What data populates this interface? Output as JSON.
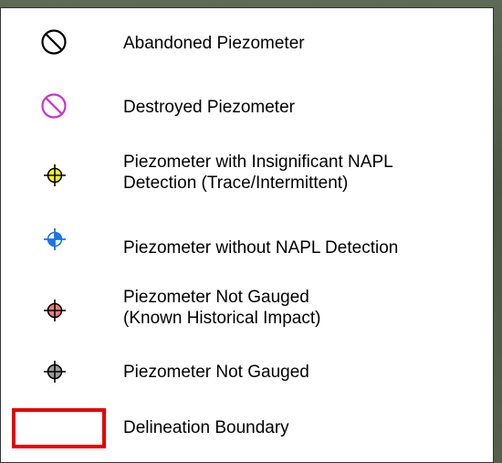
{
  "legend": {
    "items": [
      {
        "label": "Abandoned Piezometer",
        "symbol": "abandoned-piezometer-icon",
        "color": "#000000"
      },
      {
        "label": "Destroyed Piezometer",
        "symbol": "destroyed-piezometer-icon",
        "color": "#cc33cc"
      },
      {
        "label": "Piezometer with Insignificant NAPL\nDetection (Trace/Intermittent)",
        "symbol": "insignificant-napl-piezometer-icon",
        "color": "#ffff00"
      },
      {
        "label": "Piezometer without NAPL Detection",
        "symbol": "no-napl-piezometer-icon",
        "color": "#1a73e8"
      },
      {
        "label": "Piezometer Not Gauged\n(Known Historical Impact)",
        "symbol": "not-gauged-impact-piezometer-icon",
        "color": "#ef7b7b"
      },
      {
        "label": "Piezometer Not Gauged",
        "symbol": "not-gauged-piezometer-icon",
        "color": "#9a9a9a"
      },
      {
        "label": "Delineation Boundary",
        "symbol": "delineation-boundary-icon",
        "color": "#e60000"
      }
    ]
  }
}
